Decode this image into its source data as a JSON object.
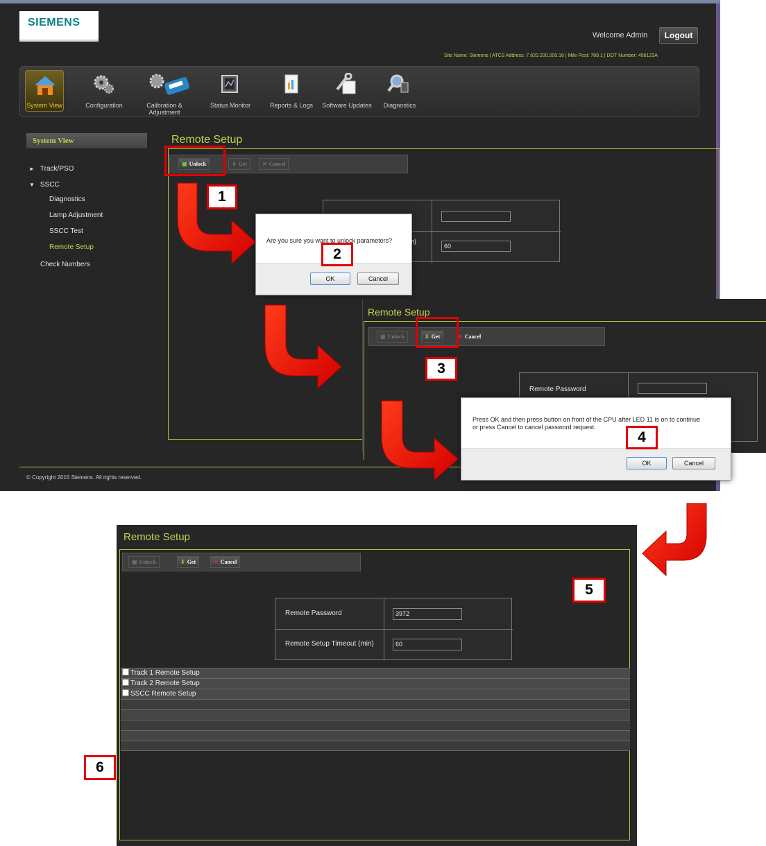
{
  "header": {
    "logo": "SIEMENS",
    "welcome": "Welcome Admin",
    "logout_label": "Logout",
    "site_info": "Site Name: Siemens | ATCS Address: 7.620.200.200.16 | Mile Post: 789.1 | DOT Number: 456123A"
  },
  "nav": {
    "items": [
      {
        "label": "System View",
        "icon": "home-icon",
        "active": true
      },
      {
        "label": "Configuration",
        "icon": "gears-icon"
      },
      {
        "label": "Calibration & Adjustment",
        "icon": "calibration-icon"
      },
      {
        "label": "Status Monitor",
        "icon": "monitor-icon"
      },
      {
        "label": "Reports & Logs",
        "icon": "report-icon"
      },
      {
        "label": "Software Updates",
        "icon": "software-update-icon"
      },
      {
        "label": "Diagnostics",
        "icon": "diagnostics-icon"
      }
    ]
  },
  "sidebar": {
    "header": "System View",
    "items": [
      {
        "label": "Track/PSO"
      },
      {
        "label": "SSCC"
      },
      {
        "label": "Diagnostics"
      },
      {
        "label": "Lamp Adjustment"
      },
      {
        "label": "SSCC Test"
      },
      {
        "label": "Remote Setup",
        "active": true
      },
      {
        "label": "Check Numbers"
      }
    ]
  },
  "main": {
    "title": "Remote Setup",
    "toolbar": {
      "unlock": "Unlock",
      "get": "Get",
      "cancel": "Cancel"
    },
    "params": {
      "timeout_value": "60"
    },
    "footer": "© Copyright 2015 Siemens. All rights reserved."
  },
  "dialog1": {
    "message": "Are you sure you want to unlock parameters?",
    "ok": "OK",
    "cancel": "Cancel"
  },
  "panel2": {
    "title": "Remote Setup",
    "password_label": "Remote Password"
  },
  "dialog2": {
    "line1": "Press OK and then press button on front of the CPU after LED 11 is on to continue",
    "line2": "or press Cancel to cancel password request.",
    "ok": "OK",
    "cancel": "Cancel"
  },
  "panel3": {
    "title": "Remote Setup",
    "password_label": "Remote Password",
    "password_value": "3972",
    "timeout_label": "Remote Setup Timeout (min)",
    "timeout_value": "60",
    "list": [
      "Track 1 Remote Setup",
      "Track 2 Remote Setup",
      "SSCC Remote Setup"
    ]
  },
  "steps": [
    "1",
    "2",
    "3",
    "4",
    "5",
    "6"
  ],
  "colors": {
    "accent": "#c7d24a",
    "annotation": "#e00000",
    "background": "#262626"
  }
}
